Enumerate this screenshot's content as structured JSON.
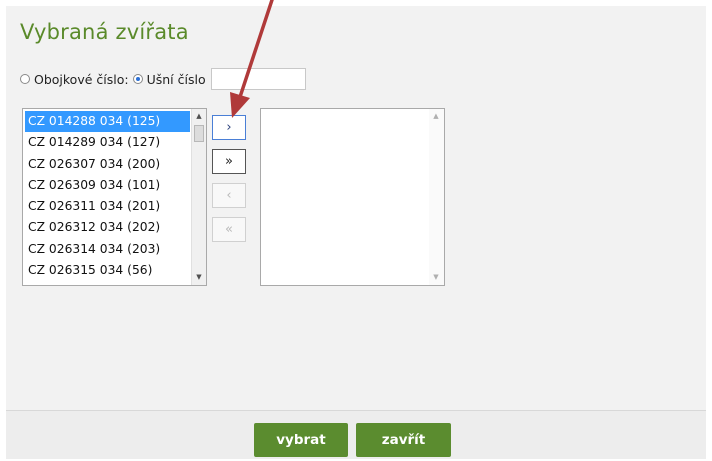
{
  "dialog": {
    "title": "Vybraná zvířata",
    "filter": {
      "option_collar": "Obojkové číslo:",
      "option_ear": "Ušní číslo",
      "selected": "ear",
      "value": ""
    },
    "available_list": {
      "items": [
        "CZ 014288 034 (125)",
        "CZ 014289 034 (127)",
        "CZ 026307 034 (200)",
        "CZ 026309 034 (101)",
        "CZ 026311 034 (201)",
        "CZ 026312 034 (202)",
        "CZ 026314 034 (203)",
        "CZ 026315 034 (56)"
      ],
      "selected_index": 0,
      "scroll_up_icon": "▲",
      "scroll_down_icon": "▼"
    },
    "selected_list": {
      "items": [],
      "scroll_up_icon": "▲",
      "scroll_down_icon": "▼"
    },
    "transfer_buttons": {
      "move_one": "›",
      "move_all": "»",
      "remove_one": "‹",
      "remove_all": "«"
    },
    "footer": {
      "select_label": "vybrat",
      "close_label": "zavřít"
    }
  },
  "colors": {
    "title": "#5a8a2a",
    "button": "#5b8c2f",
    "selection": "#3399ff",
    "annotation_arrow": "#b03a3a"
  }
}
